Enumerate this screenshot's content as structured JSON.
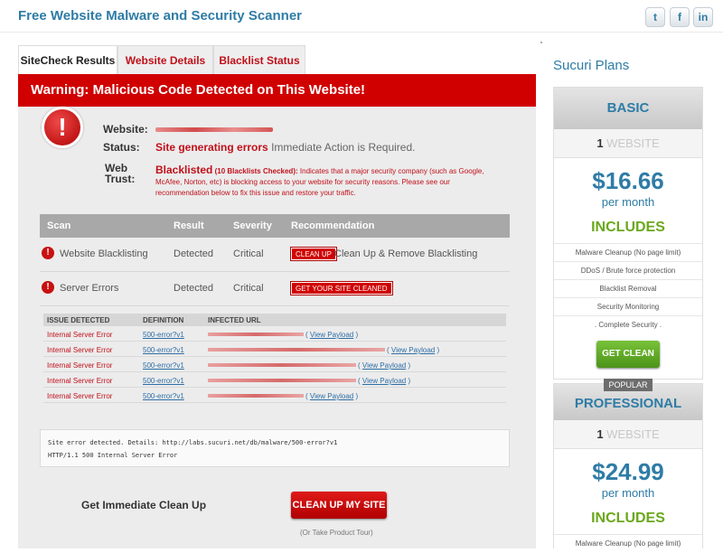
{
  "header": {
    "title": "Free Website Malware and Security Scanner",
    "social": {
      "twitter": "t",
      "facebook": "f",
      "linkedin": "in"
    }
  },
  "tabs": [
    {
      "label": "SiteCheck Results",
      "active": true
    },
    {
      "label": "Website Details",
      "active": false
    },
    {
      "label": "Blacklist Status",
      "active": false
    }
  ],
  "warning": "Warning: Malicious Code Detected on This Website!",
  "info": {
    "website_label": "Website:",
    "status_label": "Status:",
    "status_value": "Site generating errors",
    "status_note": "Immediate Action is Required.",
    "trust_label_1": "Web",
    "trust_label_2": "Trust:",
    "trust_value": "Blacklisted",
    "trust_count": "(10 Blacklists Checked):",
    "trust_text": "Indicates that a major security company (such as Google, McAfee, Norton, etc) is blocking access to your website for security reasons. Please see our recommendation below to fix this issue and restore your traffic."
  },
  "scan": {
    "columns": [
      "Scan",
      "Result",
      "Severity",
      "Recommendation"
    ],
    "rows": [
      {
        "scan": "Website Blacklisting",
        "result": "Detected",
        "severity": "Critical",
        "badge": "CLEAN UP",
        "recommendation": "Clean Up & Remove Blacklisting"
      },
      {
        "scan": "Server Errors",
        "result": "Detected",
        "severity": "Critical",
        "badge": "GET YOUR SITE CLEANED",
        "recommendation": ""
      }
    ]
  },
  "issues": {
    "columns": [
      "ISSUE DETECTED",
      "DEFINITION",
      "INFECTED URL"
    ],
    "rows": [
      {
        "issue": "Internal Server Error",
        "definition": "500-error?v1",
        "payload": "View Payload"
      },
      {
        "issue": "Internal Server Error",
        "definition": "500-error?v1",
        "payload": "View Payload"
      },
      {
        "issue": "Internal Server Error",
        "definition": "500-error?v1",
        "payload": "View Payload"
      },
      {
        "issue": "Internal Server Error",
        "definition": "500-error?v1",
        "payload": "View Payload"
      },
      {
        "issue": "Internal Server Error",
        "definition": "500-error?v1",
        "payload": "View Payload"
      }
    ]
  },
  "details": {
    "line1": "Site error detected. Details: http://labs.sucuri.net/db/malware/500-error?v1",
    "line2": "HTTP/1.1 500 Internal Server Error"
  },
  "cta": {
    "label": "Get Immediate Clean Up",
    "button": "CLEAN UP MY SITE",
    "tour": "(Or Take Product Tour)"
  },
  "sidebar": {
    "title": "Sucuri Plans",
    "plans": [
      {
        "name": "BASIC",
        "sites_count": "1",
        "sites_label": "WEBSITE",
        "price": "$16.66",
        "period": "per month",
        "includes": "INCLUDES",
        "features": [
          "Malware Cleanup (No page limit)",
          "DDoS / Brute force protection",
          "Blacklist Removal",
          "Security Monitoring",
          ". Complete Security ."
        ],
        "button": "GET CLEAN"
      },
      {
        "badge": "POPULAR",
        "name": "PROFESSIONAL",
        "sites_count": "1",
        "sites_label": "WEBSITE",
        "price": "$24.99",
        "period": "per month",
        "includes": "INCLUDES",
        "features": [
          "Malware Cleanup (No page limit)"
        ]
      }
    ]
  }
}
